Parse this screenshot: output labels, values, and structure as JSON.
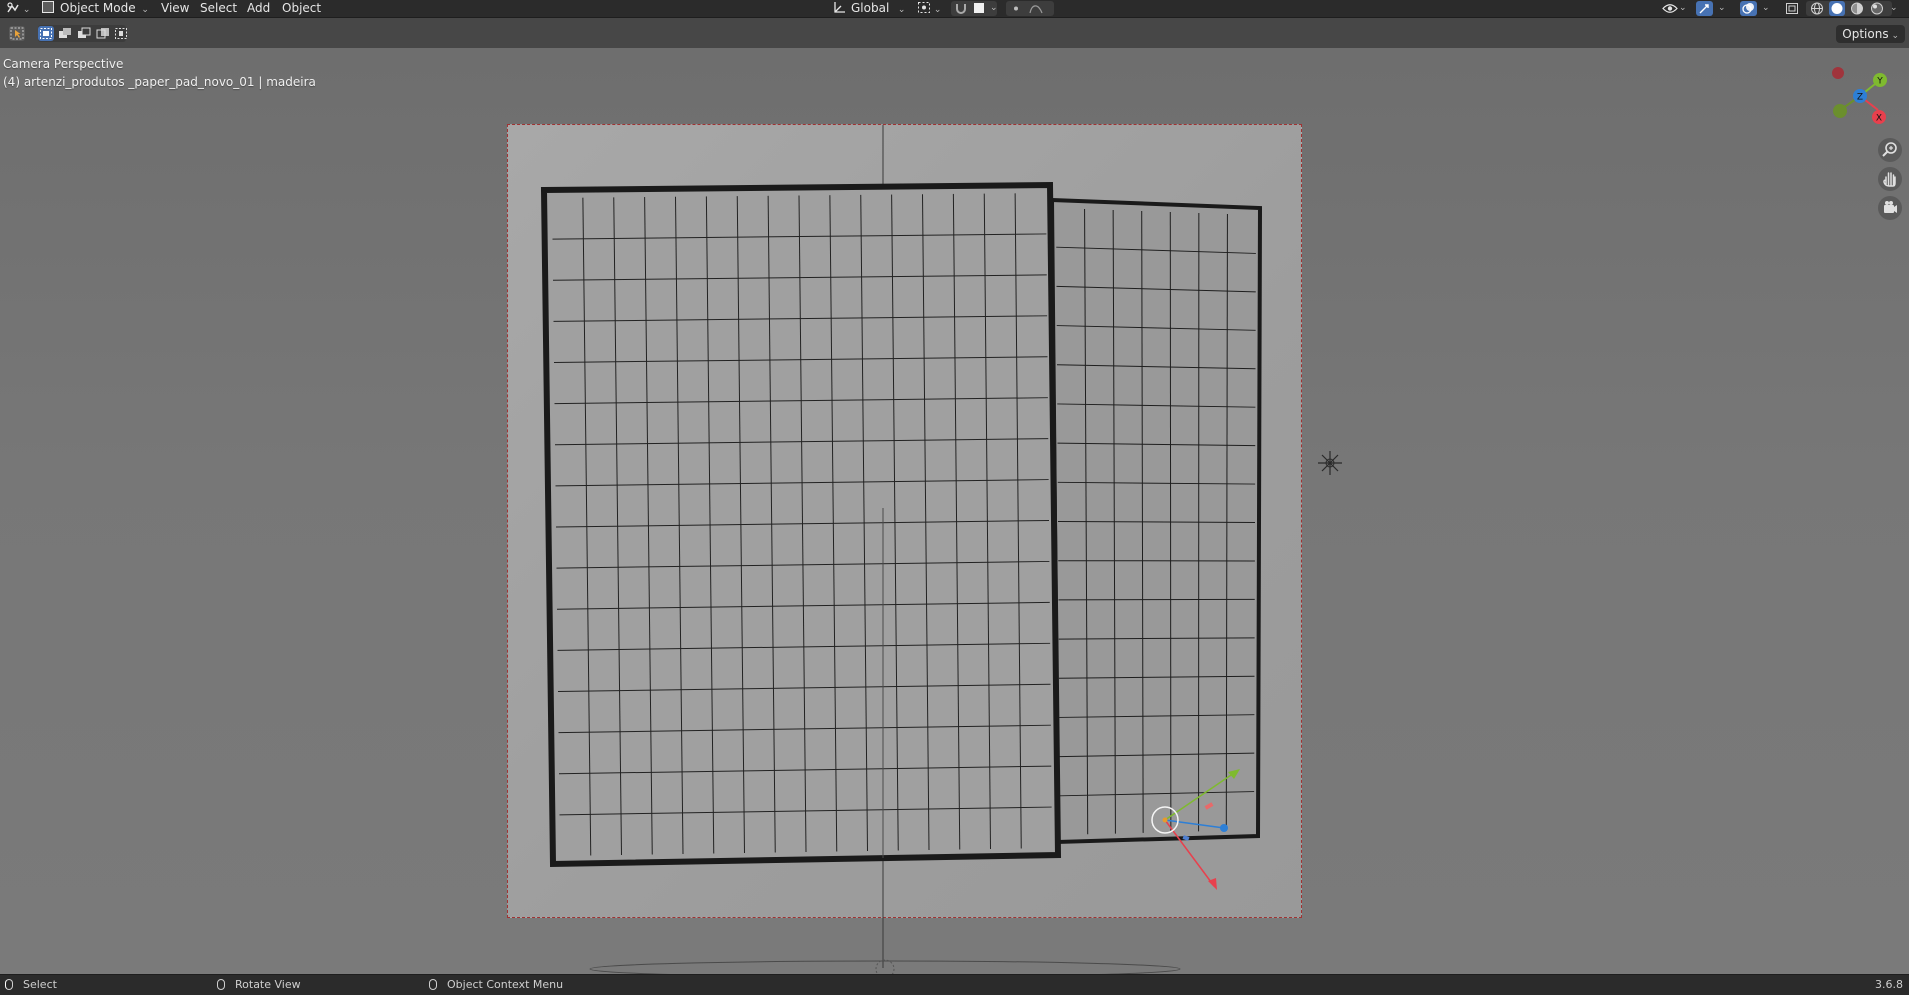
{
  "header": {
    "editor_type_icon": "camera-editor-icon",
    "mode": {
      "label": "Object Mode",
      "icon": "object-mode-icon"
    },
    "menus": [
      "View",
      "Select",
      "Add",
      "Object"
    ],
    "transform_orientation": {
      "label": "Global",
      "icon": "orientation-icon"
    },
    "pivot_icon": "pivot-point-icon",
    "snap_icon": "snap-magnet-icon",
    "snap_target_icon": "snap-increment-icon",
    "proportional_edit_icon": "proportional-edit-icon",
    "falloff_icon": "falloff-curve-icon",
    "right_icons": [
      "visibility-eye-icon",
      "gizmo-icon",
      "overlays-icon",
      "xray-icon",
      "wireframe-shading-icon",
      "solid-shading-icon",
      "material-preview-icon",
      "rendered-shading-icon"
    ]
  },
  "toolheader": {
    "active_tool_icon": "select-box-icon",
    "selection_modes": [
      "set-new-selection-icon",
      "extend-selection-icon",
      "subtract-selection-icon",
      "invert-selection-icon",
      "intersect-selection-icon"
    ],
    "options_label": "Options"
  },
  "viewport": {
    "view_name": "Camera Perspective",
    "object_info": "(4) artenzi_produtos _paper_pad_novo_01 | madeira",
    "gizmo_axes": {
      "x": "X",
      "y": "Y",
      "z": "Z"
    },
    "nav_icons": [
      "zoom-icon",
      "pan-hand-icon",
      "camera-view-icon"
    ],
    "colors": {
      "x_axis": "#e8404d",
      "y_axis": "#7fba2f",
      "z_axis": "#2d7fd6",
      "camera_frame": "#a03333"
    }
  },
  "statusbar": {
    "items": [
      {
        "icon": "left-mouse-icon",
        "label": "Select"
      },
      {
        "icon": "middle-mouse-icon",
        "label": "Rotate View"
      },
      {
        "icon": "right-mouse-icon",
        "label": "Object Context Menu"
      }
    ],
    "version": "3.6.8"
  }
}
